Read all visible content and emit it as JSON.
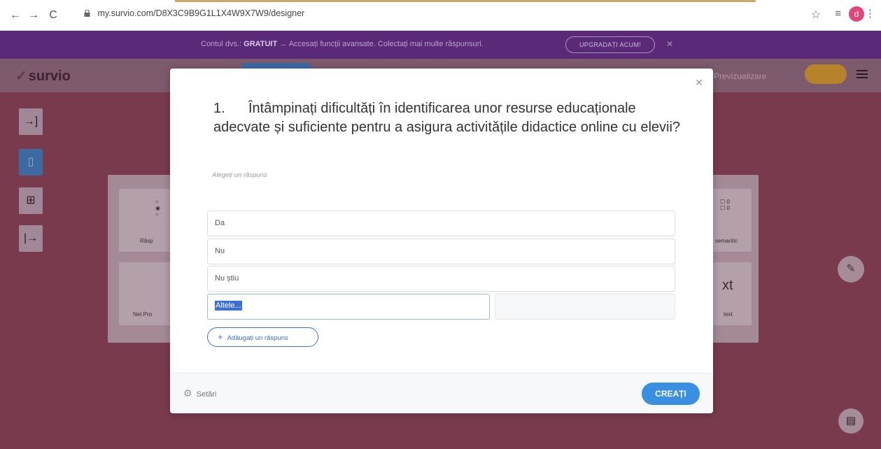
{
  "browser": {
    "url": "my.survio.com/D8X3C9B9G1L1X4W9X7W9/designer",
    "profile_initial": "d"
  },
  "promo": {
    "prefix": "Contul dvs.: ",
    "plan": "GRATUIT",
    "message": " → Accesați funcții avansate. Colectați mai multe răspunsuri.",
    "upgrade_label": "UPGRADAȚI ACUM!"
  },
  "header": {
    "logo": "survio",
    "preview_label": "Previzualizare"
  },
  "background_cards": {
    "left_top_label": "Răsp",
    "left_bottom_label": "Net Pro",
    "right_top_label": "semantic",
    "right_mid_text": "xt",
    "right_bottom_label": "text"
  },
  "modal": {
    "question_number": "1.",
    "question_text": "Întâmpinați dificultăți în identificarea unor resurse educaționale adecvate și suficiente pentru a asigura activitățile didactice online cu elevii?",
    "hint": "Alegeți un răspuns",
    "answers": [
      "Da",
      "Nu",
      "Nu știu"
    ],
    "other_label": "Altele...",
    "add_answer_label": "Adăugați un răspuns",
    "settings_label": "Setări",
    "create_label": "CREAȚI"
  },
  "colors": {
    "accent_blue": "#3b8fe0",
    "selection_blue": "#3b6fd1",
    "promo_purple": "#5a2a78"
  }
}
